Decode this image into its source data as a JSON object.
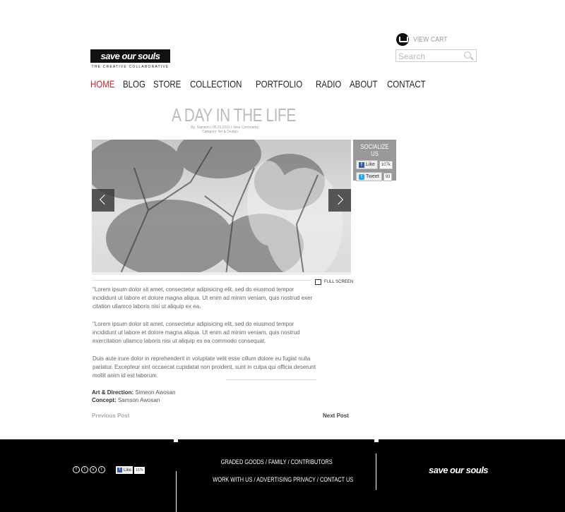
{
  "header": {
    "cart_label": "VIEW CART",
    "search_placeholder": "Search",
    "logo_text": "save our souls",
    "logo_tagline": "THE CREATIVE COLLABORATIVE"
  },
  "nav": {
    "items": [
      {
        "label": "HOME",
        "active": true
      },
      {
        "label": "BLOG",
        "active": false
      },
      {
        "label": "STORE",
        "active": false
      },
      {
        "label": "COLLECTION",
        "active": false
      },
      {
        "label": "PORTFOLIO",
        "active": false
      },
      {
        "label": "RADIO",
        "active": false
      },
      {
        "label": "ABOUT",
        "active": false
      },
      {
        "label": "CONTACT",
        "active": false
      }
    ],
    "active_color": "#c0262c"
  },
  "post": {
    "title": "A DAY IN THE LIFE",
    "meta_line1": "By: Samson | 05.31.2011 | View Comments",
    "meta_line2": "Category: Art & Design",
    "fullscreen_label": "FULL SCREEN",
    "paragraphs": [
      "\"Lorem ipsum dolor sit amet, consectetur adipisicing elit, sed do eiusmod tempor incididunt ut labore et dolore magna aliqua. Ut enim ad minim veniam, quis nostrud exer citation ullamco laboris nisi ut aliquip ex ea.",
      "\"Lorem ipsum dolor sit amet, consectetur adipisicing elit, sed do eiusmod tempor incididunt ut labore et dolore magna aliqua. Ut enim ad minim veniam, quis nostrud exercitation ullamco laboris nisi ut aliquip ex ea commodo consequat.",
      "Duis aute irure dolor in reprehenderit in voluptate velit esse cillum dolore eu fugiat nulla pariatur. Excepteur sint occaecat cupidatat non proident, sunt in culpa qui officia deserunt mollit anim id est laborum."
    ],
    "credit1_label": "Art & Direction:",
    "credit1_value": "Simeon Awosan",
    "credit2_label": "Concept:",
    "credit2_value": "Samson Awosan",
    "prev_label": "Previous Post",
    "next_label": "Next Post"
  },
  "social": {
    "title": "SOCIALIZE US",
    "like_label": "Like",
    "like_count": "107k",
    "tweet_label": "Tweet",
    "tweet_count": "93"
  },
  "footer": {
    "links_row1": "GRADED GOODS / FAMILY / CONTRIBUTORS",
    "links_row2": "WORK WITH US / ADVERTISING  PRIVACY / CONTACT US",
    "like_label": "Like",
    "like_count": "107k",
    "logo_text": "save our souls",
    "social_icons": [
      "facebook-icon",
      "twitter-icon",
      "vimeo-icon",
      "rss-icon"
    ]
  }
}
